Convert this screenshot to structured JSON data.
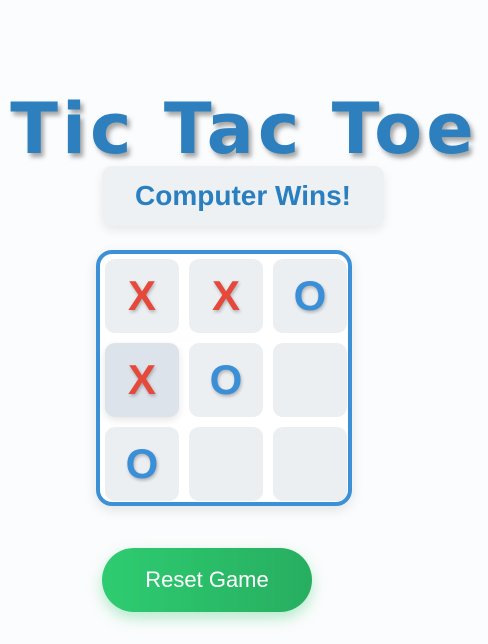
{
  "title": "Tic Tac Toe",
  "status": "Computer Wins!",
  "board": {
    "cells": [
      "X",
      "X",
      "O",
      "X",
      "O",
      "",
      "O",
      "",
      ""
    ],
    "highlighted_cell": 3
  },
  "reset_label": "Reset Game",
  "colors": {
    "title": "#2d7fbd",
    "x_mark": "#e5493c",
    "o_mark": "#3a8fd6",
    "board_border": "#3b90d6",
    "reset_button": "#2ecc71"
  }
}
